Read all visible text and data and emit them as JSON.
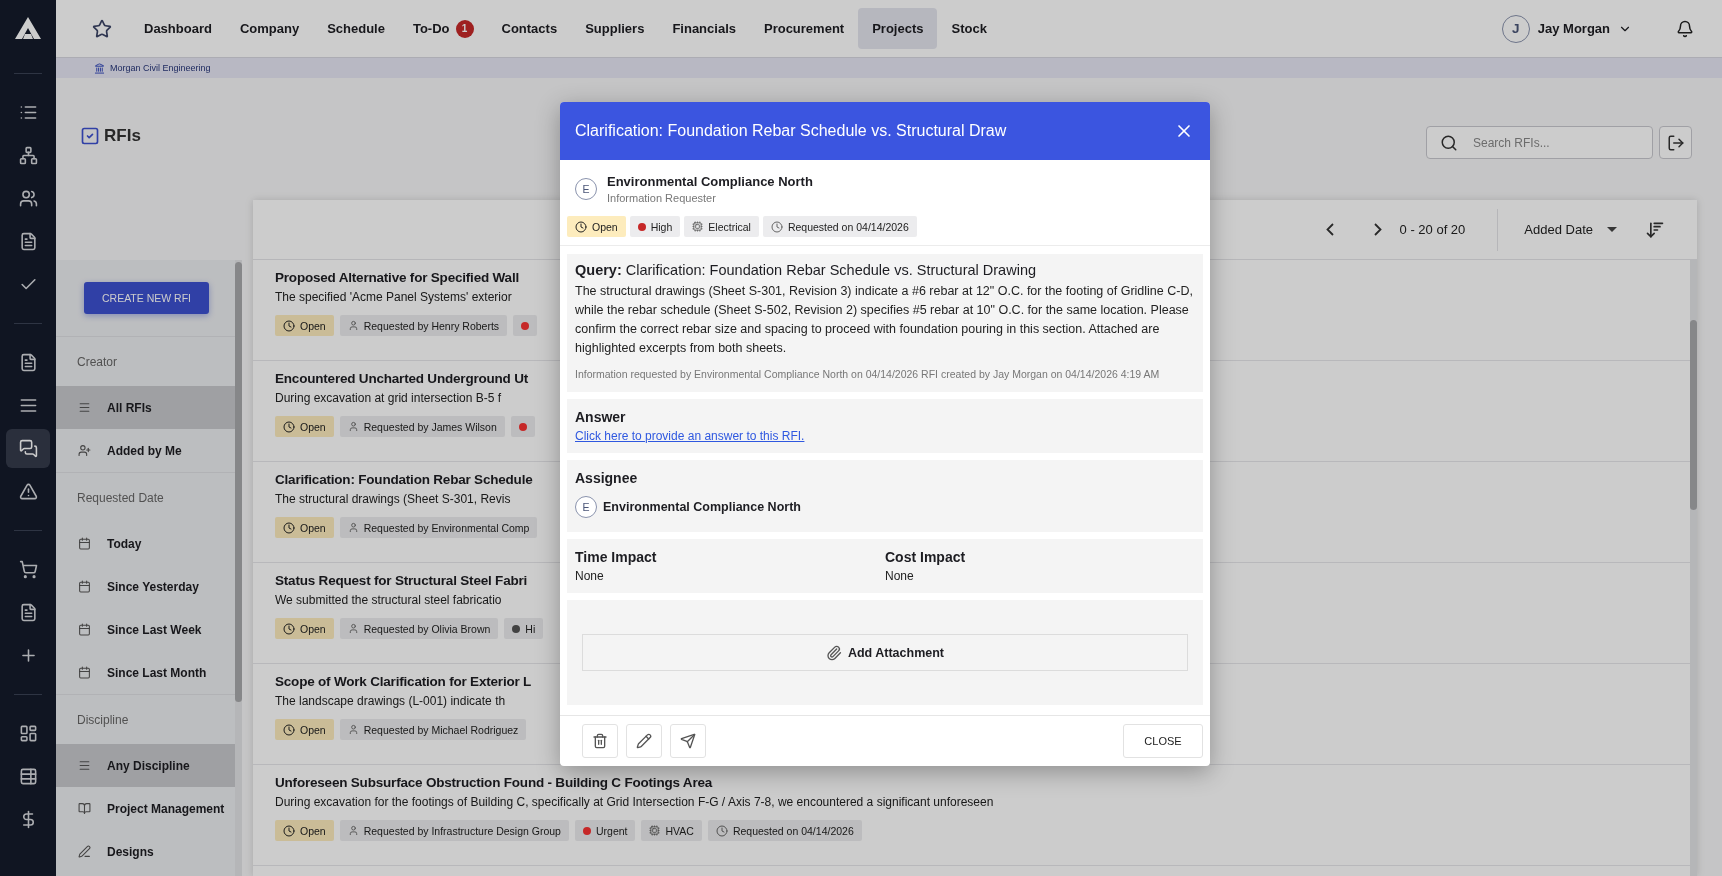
{
  "side_nav": [
    {
      "kind": "divider"
    },
    {
      "kind": "icon",
      "selected": false
    },
    {
      "kind": "icon",
      "selected": false
    },
    {
      "kind": "icon",
      "selected": false
    },
    {
      "kind": "icon",
      "selected": false
    },
    {
      "kind": "icon",
      "selected": false
    },
    {
      "kind": "divider"
    },
    {
      "kind": "icon",
      "selected": false
    },
    {
      "kind": "icon",
      "selected": false
    },
    {
      "kind": "icon",
      "selected": true
    },
    {
      "kind": "icon",
      "selected": false
    },
    {
      "kind": "divider"
    },
    {
      "kind": "icon",
      "selected": false
    },
    {
      "kind": "icon",
      "selected": false
    },
    {
      "kind": "icon",
      "selected": false
    },
    {
      "kind": "divider"
    },
    {
      "kind": "icon",
      "selected": false
    },
    {
      "kind": "icon",
      "selected": false
    },
    {
      "kind": "icon",
      "selected": false
    }
  ],
  "top_nav": {
    "items": [
      {
        "label": "Dashboard",
        "selected": false
      },
      {
        "label": "Company",
        "selected": false
      },
      {
        "label": "Schedule",
        "selected": false
      },
      {
        "label": "To-Do",
        "selected": false,
        "badge": "1"
      },
      {
        "label": "Contacts",
        "selected": false
      },
      {
        "label": "Suppliers",
        "selected": false
      },
      {
        "label": "Financials",
        "selected": false
      },
      {
        "label": "Procurement",
        "selected": false
      },
      {
        "label": "Projects",
        "selected": true
      },
      {
        "label": "Stock",
        "selected": false
      }
    ],
    "user": {
      "initial": "J",
      "name": "Jay Morgan"
    }
  },
  "breadcrumb": "Morgan Civil Engineering",
  "page": {
    "title": "RFIs",
    "search": {
      "placeholder": "Search RFIs..."
    }
  },
  "filters": {
    "create_button": "CREATE NEW RFI",
    "groups": [
      {
        "heading": "Creator",
        "items": [
          {
            "label": "All RFIs",
            "selected": true
          },
          {
            "label": "Added by Me",
            "selected": false
          }
        ]
      },
      {
        "heading": "Requested Date",
        "items": [
          {
            "label": "Today",
            "selected": false
          },
          {
            "label": "Since Yesterday",
            "selected": false
          },
          {
            "label": "Since Last Week",
            "selected": false
          },
          {
            "label": "Since Last Month",
            "selected": false
          }
        ]
      },
      {
        "heading": "Discipline",
        "items": [
          {
            "label": "Any Discipline",
            "selected": true
          },
          {
            "label": "Project Management",
            "selected": false
          },
          {
            "label": "Designs",
            "selected": false
          }
        ]
      }
    ]
  },
  "list": {
    "pagination": "0 - 20 of 20",
    "sort": "Added Date",
    "rows": [
      {
        "title": "Proposed Alternative for Specified Wall",
        "description": "The specified 'Acme Panel Systems' exterior",
        "tags": [
          {
            "kind": "status",
            "label": "Open"
          },
          {
            "kind": "requester",
            "label": "Requested by Henry Roberts"
          },
          {
            "kind": "priority",
            "color": "#c62828"
          }
        ]
      },
      {
        "title": "Encountered Uncharted Underground Ut",
        "description": "During excavation at grid intersection B-5 f",
        "tags": [
          {
            "kind": "status",
            "label": "Open"
          },
          {
            "kind": "requester",
            "label": "Requested by James Wilson"
          },
          {
            "kind": "priority",
            "color": "#c62828"
          }
        ]
      },
      {
        "title": "Clarification: Foundation Rebar Schedule",
        "description": "The structural drawings (Sheet S-301, Revis",
        "tags": [
          {
            "kind": "status",
            "label": "Open"
          },
          {
            "kind": "requester",
            "label": "Requested by Environmental Comp"
          }
        ]
      },
      {
        "title": "Status Request for Structural Steel Fabri",
        "description": "We submitted the structural steel fabricatio",
        "tags": [
          {
            "kind": "status",
            "label": "Open"
          },
          {
            "kind": "requester",
            "label": "Requested by Olivia Brown"
          },
          {
            "kind": "priority",
            "label": "Hi",
            "color": "#424242"
          }
        ]
      },
      {
        "title": "Scope of Work Clarification for Exterior L",
        "description": "The landscape drawings (L-001) indicate th",
        "tags": [
          {
            "kind": "status",
            "label": "Open"
          },
          {
            "kind": "requester",
            "label": "Requested by Michael Rodriguez"
          }
        ]
      },
      {
        "title": "Unforeseen Subsurface Obstruction Found - Building C Footings Area",
        "description": "During excavation for the footings of Building C, specifically at Grid Intersection F-G / Axis 7-8, we encountered a significant unforeseen",
        "tags": [
          {
            "kind": "status",
            "label": "Open"
          },
          {
            "kind": "requester",
            "label": "Requested by Infrastructure Design Group"
          },
          {
            "kind": "priority",
            "label": "Urgent",
            "color": "#c62828"
          },
          {
            "kind": "discipline",
            "label": "HVAC"
          },
          {
            "kind": "date",
            "label": "Requested on 04/14/2026"
          }
        ]
      }
    ]
  },
  "modal": {
    "title": "Clarification: Foundation Rebar Schedule vs. Structural Draw",
    "requester": {
      "initial": "E",
      "name": "Environmental Compliance North",
      "role": "Information Requester"
    },
    "tags": [
      {
        "kind": "status",
        "label": "Open"
      },
      {
        "kind": "priority",
        "label": "High",
        "color": "#c62828"
      },
      {
        "kind": "discipline",
        "label": "Electrical"
      },
      {
        "kind": "date",
        "label": "Requested on 04/14/2026"
      }
    ],
    "query": {
      "title": "**Query:** Clarification: Foundation Rebar Schedule vs. Structural Drawing",
      "body": "The structural drawings (Sheet S-301, Revision 3) indicate a #6 rebar at 12\" O.C. for the footing of Gridline C-D, while the rebar schedule (Sheet S-502, Revision 2) specifies #5 rebar at 10\" O.C. for the same location. Please confirm the correct rebar size and spacing to proceed with foundation pouring in this section. Attached are highlighted excerpts from both sheets.",
      "meta": "Information requested by Environmental Compliance North on 04/14/2026 RFI created by Jay Morgan on 04/14/2026 4:19 AM"
    },
    "answer": {
      "heading": "Answer",
      "link": "Click here to provide an answer to this RFI."
    },
    "assignee": {
      "heading": "Assignee",
      "initial": "E",
      "name": "Environmental Compliance North"
    },
    "impacts": [
      {
        "heading": "Time Impact",
        "value": "None"
      },
      {
        "heading": "Cost Impact",
        "value": "None"
      }
    ],
    "attachment_button": "Add Attachment",
    "close_button": "CLOSE"
  }
}
